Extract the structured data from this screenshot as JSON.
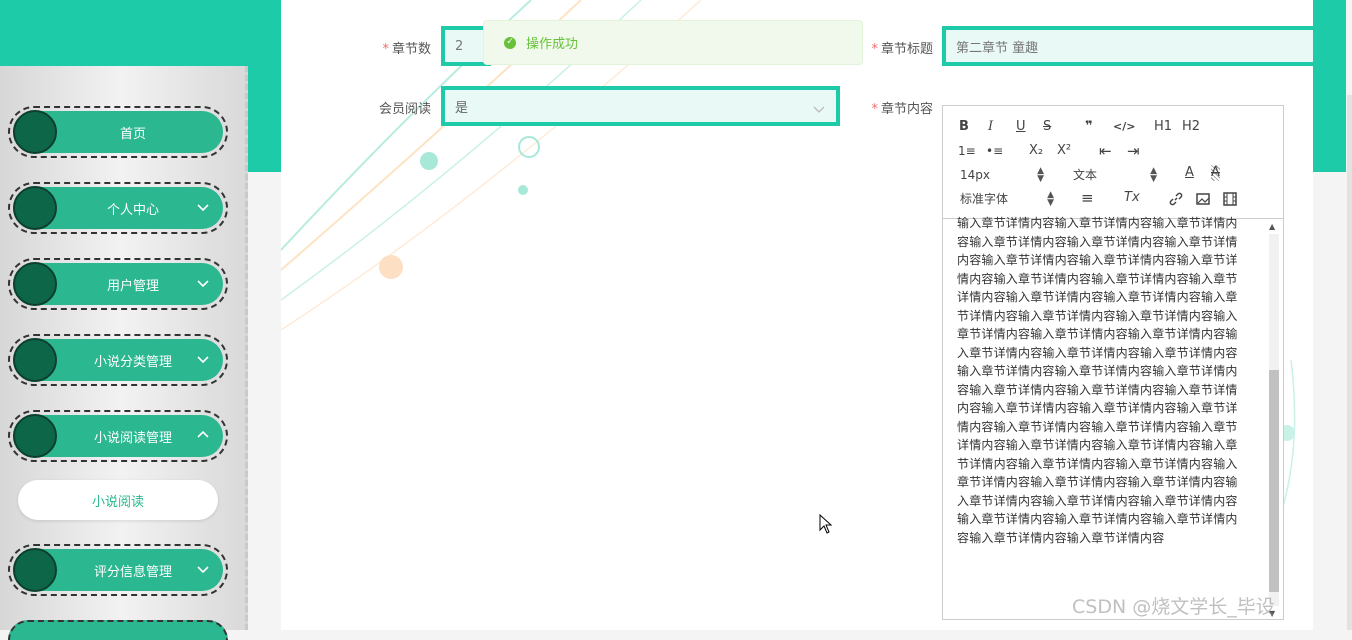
{
  "sidebar": {
    "items": [
      {
        "label": "首页",
        "has_arrow": false
      },
      {
        "label": "个人中心",
        "has_arrow": true,
        "arrow": "down"
      },
      {
        "label": "用户管理",
        "has_arrow": true,
        "arrow": "down"
      },
      {
        "label": "小说分类管理",
        "has_arrow": true,
        "arrow": "down"
      },
      {
        "label": "小说阅读管理",
        "has_arrow": true,
        "arrow": "up"
      },
      {
        "label": "评分信息管理",
        "has_arrow": true,
        "arrow": "down"
      }
    ],
    "submenu": {
      "label": "小说阅读"
    }
  },
  "form": {
    "chapter_num": {
      "label": "章节数",
      "required": "*",
      "value": "2"
    },
    "chapter_title": {
      "label": "章节标题",
      "required": "*",
      "value": "第二章节 童趣"
    },
    "member_read": {
      "label": "会员阅读",
      "value": "是"
    },
    "chapter_content": {
      "label": "章节内容",
      "required": "*"
    }
  },
  "toast": {
    "message": "操作成功",
    "icon": "check-circle-icon"
  },
  "editor": {
    "toolbar": {
      "bold": "B",
      "italic": "I",
      "underline": "U",
      "strike": "S",
      "quote": "❞",
      "code": "</>",
      "h1": "H1",
      "h2": "H2",
      "ordered_list": "1≡",
      "bullet_list": "•≡",
      "subscript": "X₂",
      "superscript": "X²",
      "outdent": "⇤",
      "indent": "⇥",
      "size": "14px",
      "header": "文本",
      "color": "A",
      "background": "A",
      "font": "标准字体",
      "align": "≡",
      "clean": "Tx",
      "link": "link-icon",
      "image": "image-icon",
      "video": "video-icon"
    },
    "content": "输入章节详情内容输入章节详情内容输入章节详情内容输入章节详情内容输入章节详情内容输入章节详情内容输入章节详情内容输入章节详情内容输入章节详情内容输入章节详情内容输入章节详情内容输入章节详情内容输入章节详情内容输入章节详情内容输入章节详情内容输入章节详情内容输入章节详情内容输入章节详情内容输入章节详情内容输入章节详情内容输入章节详情内容输入章节详情内容输入章节详情内容输入章节详情内容输入章节详情内容输入章节详情内容输入章节详情内容输入章节详情内容输入章节详情内容输入章节详情内容输入章节详情内容输入章节详情内容输入章节详情内容输入章节详情内容输入章节详情内容输入章节详情内容输入章节详情内容输入章节详情内容输入章节详情内容输入章节详情内容输入章节详情内容输入章节详情内容输入章节详情内容输入章节详情内容输入章节详情内容输入章节详情内容输入章节详情内容输入章节详情内容输入章节详情内容输入章节详情内容输入章节详情内容"
  },
  "watermark": "CSDN @烧文学长_毕设",
  "colors": {
    "accent": "#1ecba8",
    "menu": "#2bb78f",
    "menu_circle": "#0e6649",
    "success": "#67c23a",
    "required": "#f56c6c"
  }
}
